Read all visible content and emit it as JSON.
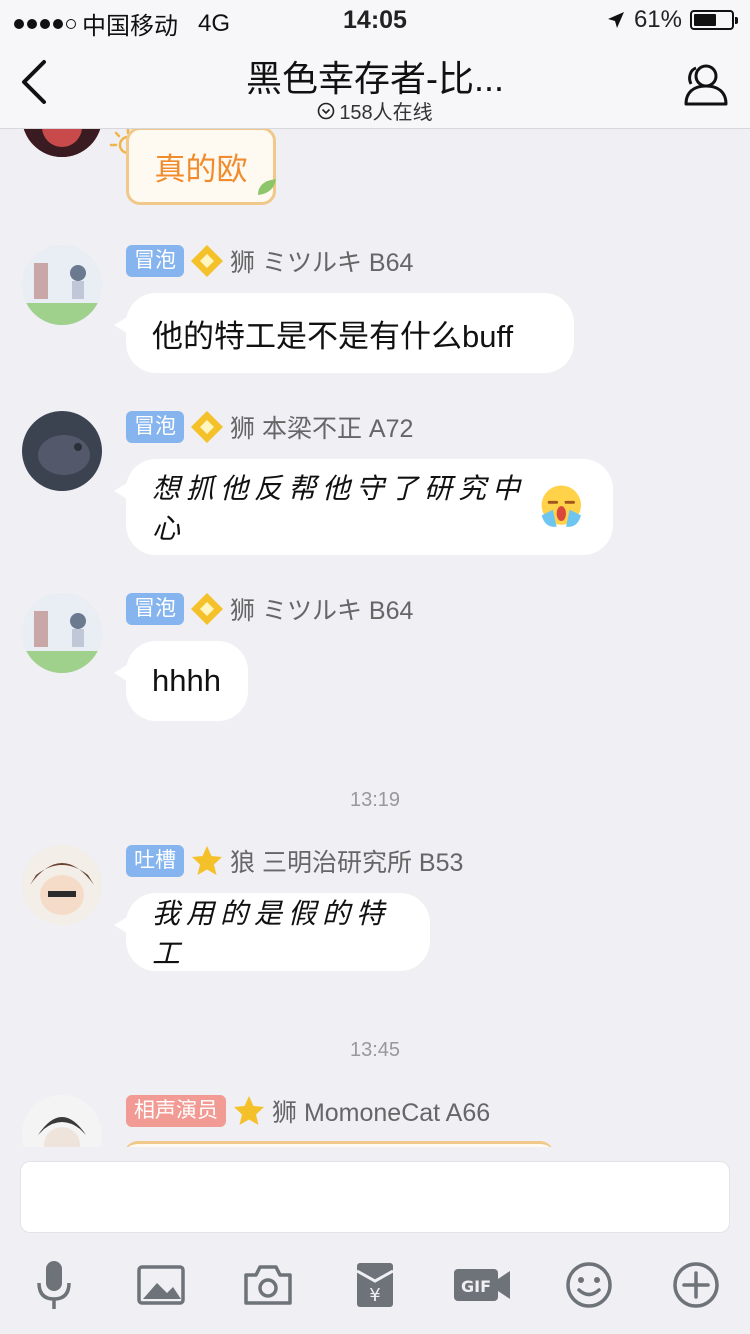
{
  "status": {
    "carrier": "中国移动",
    "network": "4G",
    "time": "14:05",
    "battery": "61%",
    "battery_level": 0.61
  },
  "nav": {
    "title": "黑色幸存者-比...",
    "online": "158人在线"
  },
  "messages": [
    {
      "text": "真的欧"
    },
    {
      "tag": "冒泡",
      "name": "狮 ミツルキ B64",
      "text": "他的特工是不是有什么buff"
    },
    {
      "tag": "冒泡",
      "name": "狮 本梁不正 A72",
      "text": "想抓他反帮他守了研究中心"
    },
    {
      "tag": "冒泡",
      "name": "狮 ミツルキ B64",
      "text": "hhhh"
    },
    {
      "tag": "吐槽",
      "name": "狼 三明治研究所 B53",
      "text": "我用的是假的特工"
    },
    {
      "tag": "相声演员",
      "name": "狮  MomoneCat A66"
    }
  ],
  "timestamps": [
    "13:19",
    "13:45"
  ],
  "toolbar": [
    "mic-icon",
    "image-icon",
    "camera-icon",
    "red-packet-icon",
    "gif-icon",
    "emoji-icon",
    "plus-icon"
  ],
  "colors": {
    "tag_blue": "#85b4ee",
    "tag_red": "#f29b95",
    "gold": "#f0c98a"
  }
}
